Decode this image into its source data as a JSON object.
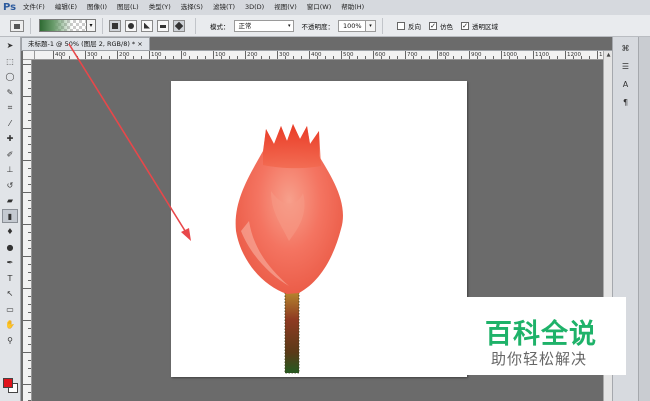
{
  "app": {
    "logo": "Ps"
  },
  "menu": [
    "文件(F)",
    "编辑(E)",
    "图像(I)",
    "图层(L)",
    "类型(Y)",
    "选择(S)",
    "滤镜(T)",
    "3D(D)",
    "视图(V)",
    "窗口(W)",
    "帮助(H)"
  ],
  "options": {
    "mode_label": "模式：",
    "mode_value": "正常",
    "opacity_label": "不透明度：",
    "opacity_value": "100%",
    "reverse_label": "反向",
    "dither_label": "仿色",
    "transparency_label": "透明区域",
    "reverse_checked": false,
    "dither_checked": true,
    "transparency_checked": true,
    "gradient_colors": [
      "#2f6b33",
      "#6a9c6c",
      "transparent"
    ]
  },
  "document": {
    "tab_title": "未标题-1 @ 50% (图层 2, RGB/8) *",
    "close": "×"
  },
  "ruler": {
    "top_labels": [
      "400",
      "300",
      "200",
      "100",
      "0",
      "100",
      "200",
      "300",
      "400",
      "500",
      "600",
      "700",
      "800",
      "900",
      "1000",
      "1100",
      "1200",
      "1300",
      "1400"
    ]
  },
  "colors": {
    "foreground": "#e0141c",
    "background": "#ffffff",
    "arrow": "#e8474a",
    "watermark_green": "#1eb269"
  },
  "tools": [
    "move-icon",
    "marquee-icon",
    "lasso-icon",
    "quick-select-icon",
    "crop-icon",
    "eyedropper-icon",
    "healing-icon",
    "brush-icon",
    "stamp-icon",
    "history-brush-icon",
    "eraser-icon",
    "gradient-icon",
    "blur-icon",
    "dodge-icon",
    "pen-icon",
    "type-icon",
    "path-select-icon",
    "shape-icon",
    "hand-icon",
    "zoom-icon"
  ],
  "watermark": {
    "title": "百科全说",
    "subtitle": "助你轻松解决"
  }
}
